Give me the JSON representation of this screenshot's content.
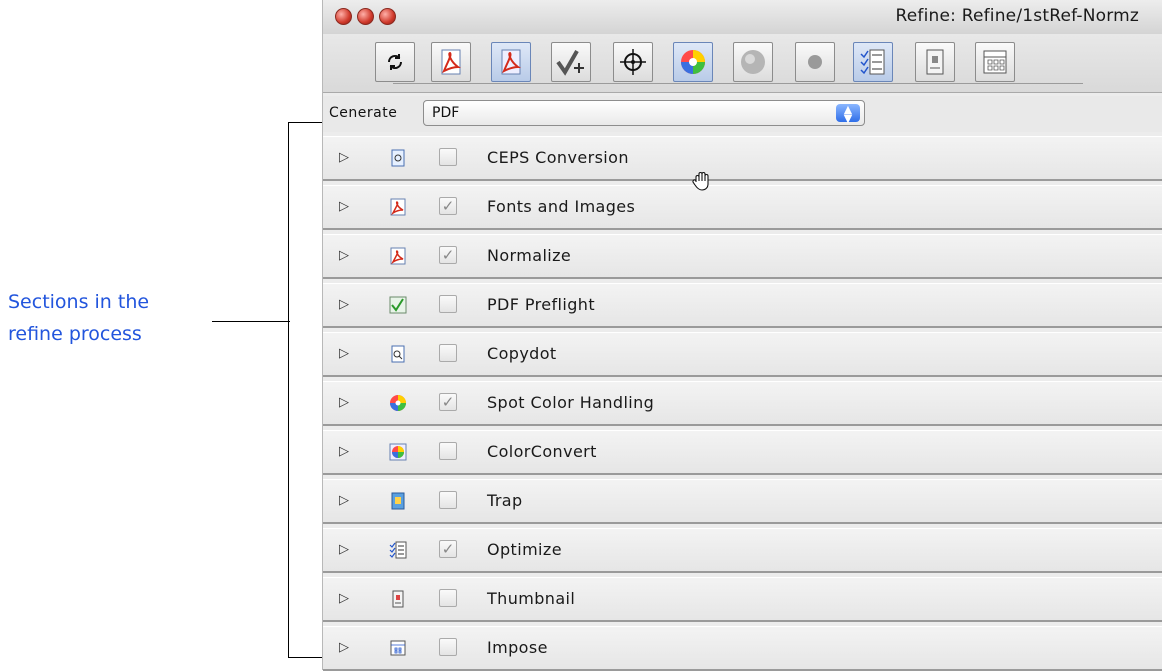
{
  "annotation": {
    "line1": "Sections in the",
    "line2": "refine process"
  },
  "window": {
    "title": "Refine: Refine/1stRef-Normz"
  },
  "toolbar": {
    "icons": [
      "refresh-icon",
      "pdf-doc-icon",
      "pdf-doc-selected-icon",
      "check-plus-icon",
      "crosshair-icon",
      "color-wheel-icon",
      "gray-sphere-icon",
      "gray-dot-icon",
      "checklist-icon",
      "page-icon",
      "impose-grid-icon"
    ]
  },
  "generate": {
    "label": "Cenerate",
    "value": "PDF"
  },
  "sections": [
    {
      "label": "CEPS Conversion",
      "checked": false
    },
    {
      "label": "Fonts and Images",
      "checked": true
    },
    {
      "label": "Normalize",
      "checked": true
    },
    {
      "label": "PDF Preflight",
      "checked": false
    },
    {
      "label": "Copydot",
      "checked": false
    },
    {
      "label": "Spot Color Handling",
      "checked": true
    },
    {
      "label": "ColorConvert",
      "checked": false
    },
    {
      "label": "Trap",
      "checked": false
    },
    {
      "label": "Optimize",
      "checked": true
    },
    {
      "label": "Thumbnail",
      "checked": false
    },
    {
      "label": "Impose",
      "checked": false
    }
  ],
  "colors": {
    "annotation": "#2255dd",
    "window_bg": "#ececec",
    "select_arrows": "#2f6ee8"
  }
}
